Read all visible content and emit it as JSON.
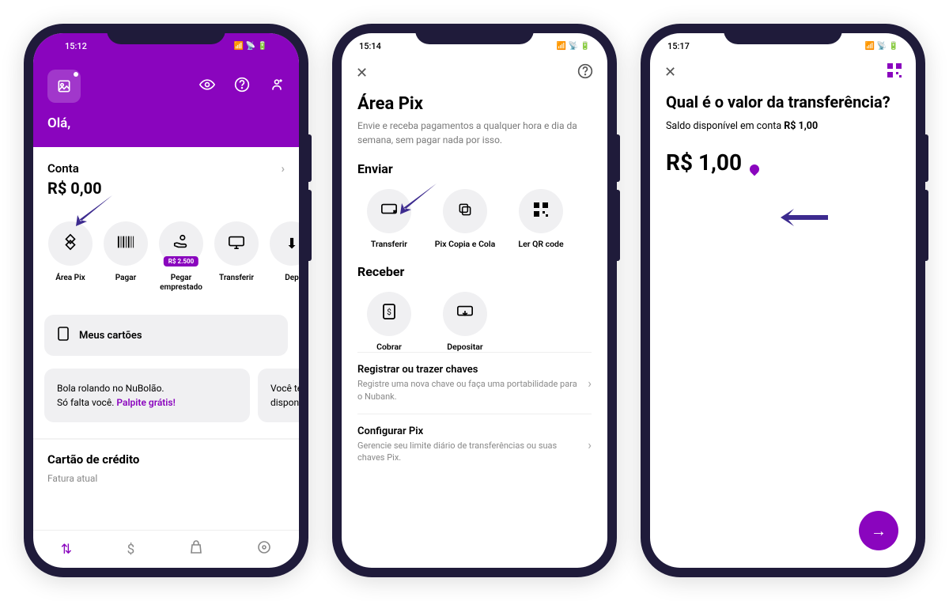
{
  "colors": {
    "brand": "#8a05be",
    "phone_body": "#1f1b3a"
  },
  "phone1": {
    "time": "15:12",
    "greeting": "Olá,",
    "account_label": "Conta",
    "account_balance": "R$ 0,00",
    "actions": [
      {
        "label": "Área Pix",
        "icon": "pix-icon"
      },
      {
        "label": "Pagar",
        "icon": "barcode-icon"
      },
      {
        "label": "Pegar emprestado",
        "icon": "hand-money-icon",
        "badge": "R$ 2.500"
      },
      {
        "label": "Transferir",
        "icon": "transfer-out-icon"
      },
      {
        "label": "Dep",
        "icon": "deposit-icon"
      }
    ],
    "cards_button": "Meus cartões",
    "promo1_line1": "Bola rolando no NuBolão.",
    "promo1_line2_a": "Só falta você. ",
    "promo1_link": "Palpite grátis!",
    "promo2_line1": "Você te",
    "promo2_line2": "dispon",
    "cc_title": "Cartão de crédito",
    "cc_sub": "Fatura atual"
  },
  "phone2": {
    "time": "15:14",
    "title": "Área Pix",
    "subtitle": "Envie e receba pagamentos a qualquer hora e dia da semana, sem pagar nada por isso.",
    "send_title": "Enviar",
    "send_actions": [
      {
        "label": "Transferir",
        "icon": "transfer-out-icon"
      },
      {
        "label": "Pix Copia e Cola",
        "icon": "copy-icon"
      },
      {
        "label": "Ler QR code",
        "icon": "qr-icon"
      }
    ],
    "receive_title": "Receber",
    "receive_actions": [
      {
        "label": "Cobrar",
        "icon": "charge-icon"
      },
      {
        "label": "Depositar",
        "icon": "deposit-icon"
      }
    ],
    "settings": [
      {
        "title": "Registrar ou trazer chaves",
        "sub": "Registre uma nova chave ou faça uma portabilidade para o Nubank."
      },
      {
        "title": "Configurar Pix",
        "sub": "Gerencie seu limite diário de transferências ou suas chaves Pix."
      }
    ]
  },
  "phone3": {
    "time": "15:17",
    "title": "Qual é o valor da transferência?",
    "balance_prefix": "Saldo disponível em conta ",
    "balance_value": "R$ 1,00",
    "amount": "R$ 1,00"
  }
}
